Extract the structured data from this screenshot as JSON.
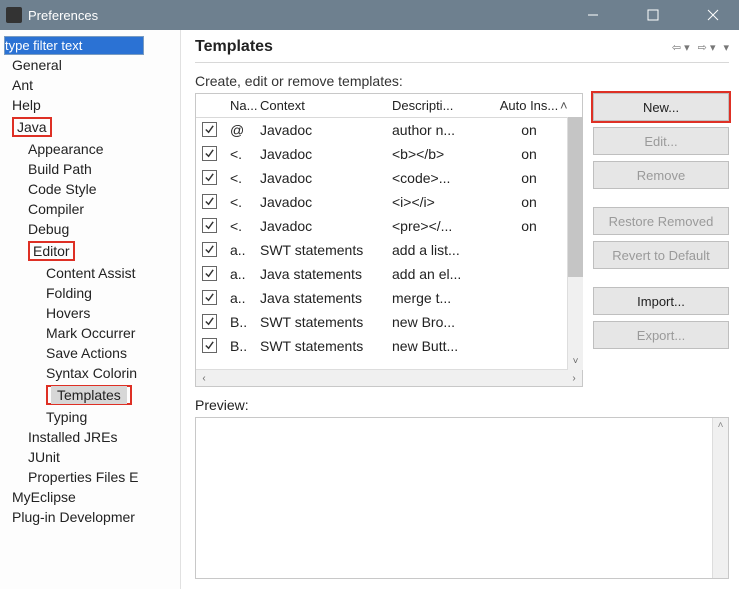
{
  "window": {
    "title": "Preferences"
  },
  "sidebar": {
    "filter_placeholder": "type filter text",
    "items": [
      {
        "label": "General",
        "lvl": 0
      },
      {
        "label": "Ant",
        "lvl": 0
      },
      {
        "label": "Help",
        "lvl": 0
      },
      {
        "label": "Java",
        "lvl": 0,
        "highlight": true
      },
      {
        "label": "Appearance",
        "lvl": 1
      },
      {
        "label": "Build Path",
        "lvl": 1
      },
      {
        "label": "Code Style",
        "lvl": 1
      },
      {
        "label": "Compiler",
        "lvl": 1
      },
      {
        "label": "Debug",
        "lvl": 1
      },
      {
        "label": "Editor",
        "lvl": 1,
        "highlight": true
      },
      {
        "label": "Content Assist",
        "lvl": 2
      },
      {
        "label": "Folding",
        "lvl": 2
      },
      {
        "label": "Hovers",
        "lvl": 2
      },
      {
        "label": "Mark Occurrer",
        "lvl": 2
      },
      {
        "label": "Save Actions",
        "lvl": 2
      },
      {
        "label": "Syntax Colorin",
        "lvl": 2
      },
      {
        "label": "Templates",
        "lvl": 2,
        "selected": true,
        "highlight": true
      },
      {
        "label": "Typing",
        "lvl": 2
      },
      {
        "label": "Installed JREs",
        "lvl": 1
      },
      {
        "label": "JUnit",
        "lvl": 1
      },
      {
        "label": "Properties Files E",
        "lvl": 1
      },
      {
        "label": "MyEclipse",
        "lvl": 0
      },
      {
        "label": "Plug-in Developmer",
        "lvl": 0
      }
    ]
  },
  "main": {
    "title": "Templates",
    "instruction": "Create, edit or remove templates:",
    "preview_label": "Preview:",
    "columns": {
      "name": "Na...",
      "context": "Context",
      "desc": "Descripti...",
      "auto": "Auto Ins..."
    },
    "rows": [
      {
        "chk": true,
        "name": "@",
        "ctx": "Javadoc",
        "desc": "author n...",
        "auto": "on"
      },
      {
        "chk": true,
        "name": "<.",
        "ctx": "Javadoc",
        "desc": "<b></b>",
        "auto": "on"
      },
      {
        "chk": true,
        "name": "<.",
        "ctx": "Javadoc",
        "desc": "<code>...",
        "auto": "on"
      },
      {
        "chk": true,
        "name": "<.",
        "ctx": "Javadoc",
        "desc": "<i></i>",
        "auto": "on"
      },
      {
        "chk": true,
        "name": "<.",
        "ctx": "Javadoc",
        "desc": "<pre></...",
        "auto": "on"
      },
      {
        "chk": true,
        "name": "a..",
        "ctx": "SWT statements",
        "desc": "add a list...",
        "auto": ""
      },
      {
        "chk": true,
        "name": "a..",
        "ctx": "Java statements",
        "desc": "add an el...",
        "auto": ""
      },
      {
        "chk": true,
        "name": "a..",
        "ctx": "Java statements",
        "desc": "merge t...",
        "auto": ""
      },
      {
        "chk": true,
        "name": "B..",
        "ctx": "SWT statements",
        "desc": "new Bro...",
        "auto": ""
      },
      {
        "chk": true,
        "name": "B..",
        "ctx": "SWT statements",
        "desc": "new Butt...",
        "auto": ""
      }
    ],
    "buttons": {
      "new": "New...",
      "edit": "Edit...",
      "remove": "Remove",
      "restore": "Restore Removed",
      "revert": "Revert to Default",
      "import": "Import...",
      "export": "Export..."
    }
  }
}
